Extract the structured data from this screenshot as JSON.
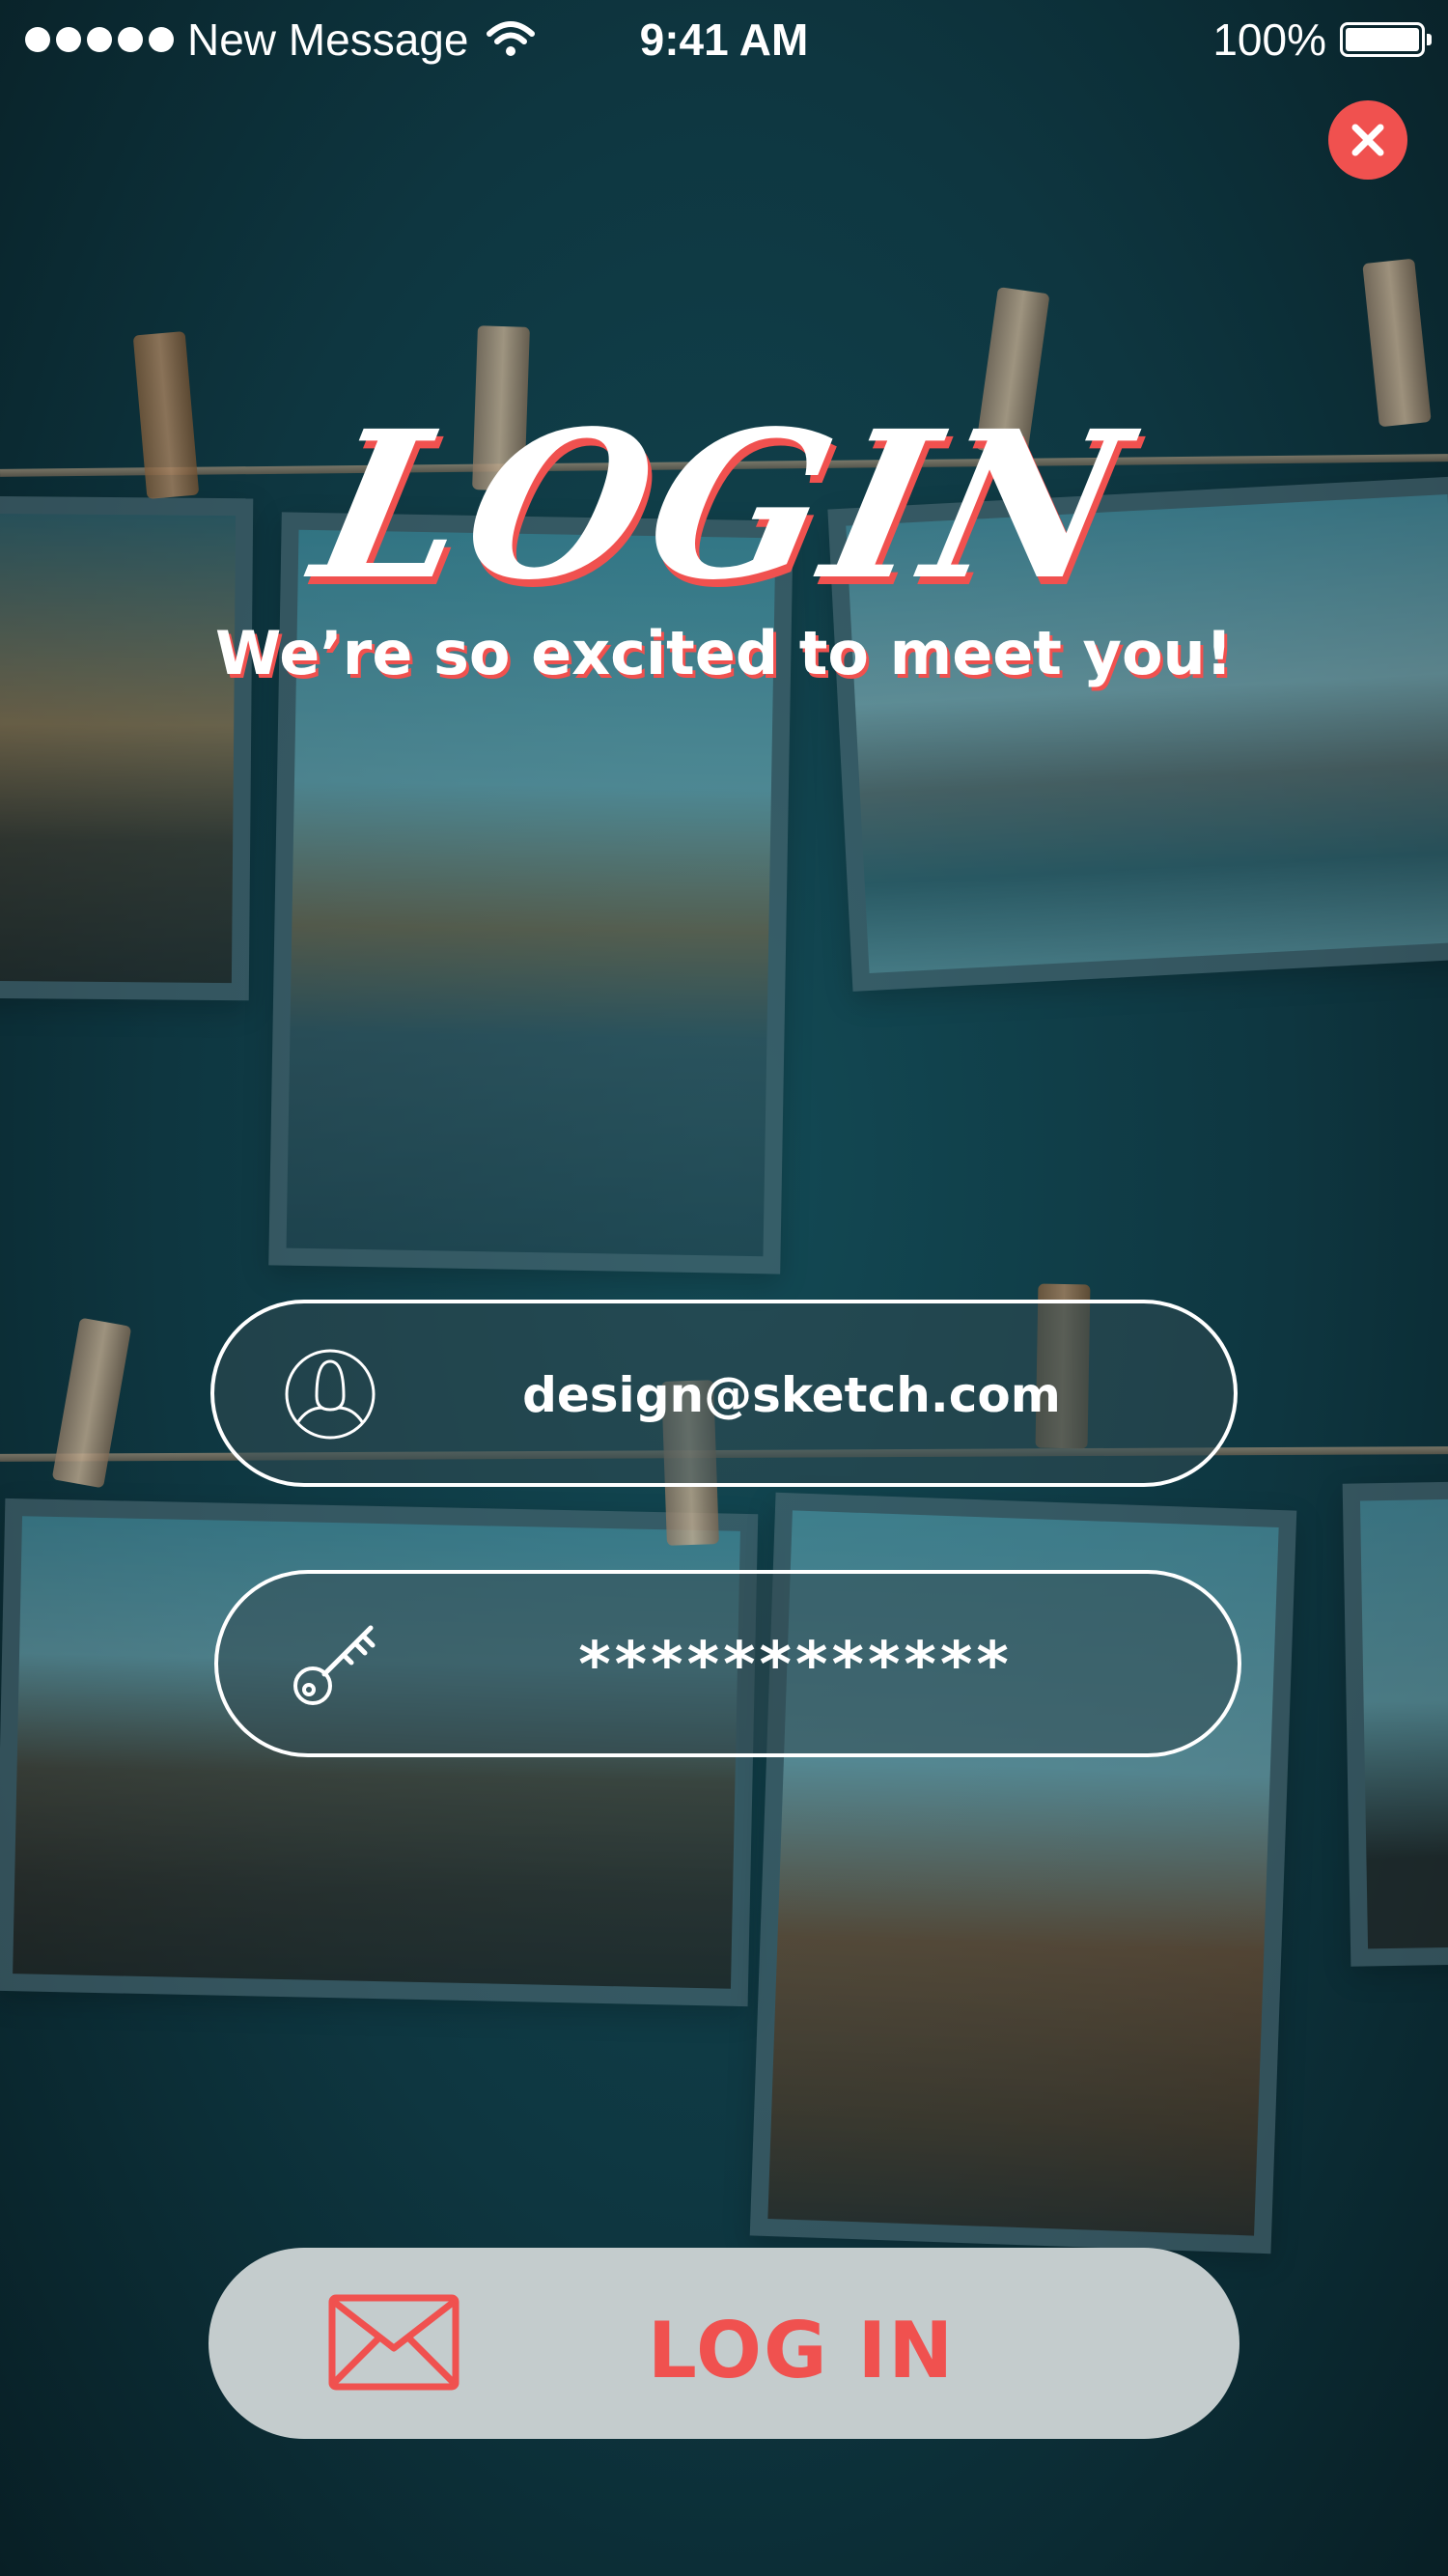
{
  "status_bar": {
    "carrier": "New Message",
    "time": "9:41 AM",
    "battery": "100%"
  },
  "title": "LOGIN",
  "subtitle": "We’re so excited to meet you!",
  "form": {
    "email": {
      "value": "design@sketch.com",
      "icon": "user-icon"
    },
    "password": {
      "value": "************",
      "icon": "key-icon"
    }
  },
  "login_button": {
    "label": "LOG IN",
    "icon": "mail-icon"
  },
  "colors": {
    "accent": "#f0514f",
    "background": "#0e3640",
    "button": "#c4cccd"
  }
}
